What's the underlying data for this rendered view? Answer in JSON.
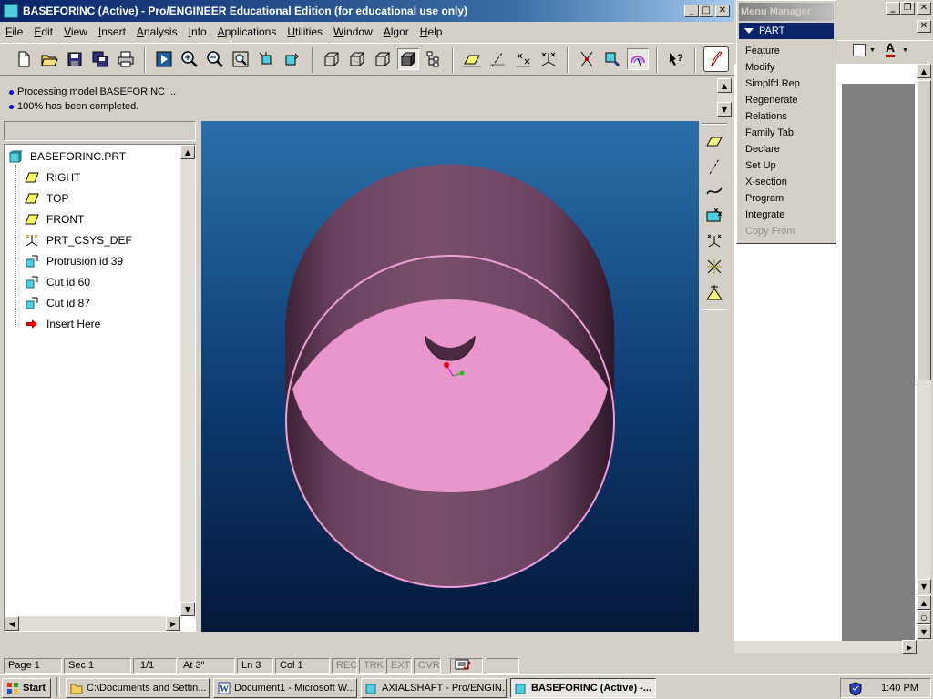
{
  "window": {
    "title": "BASEFORINC (Active) - Pro/ENGINEER Educational Edition (for educational use only)"
  },
  "menubar": [
    "File",
    "Edit",
    "View",
    "Insert",
    "Analysis",
    "Info",
    "Applications",
    "Utilities",
    "Window",
    "Algor",
    "Help"
  ],
  "messages": [
    "Processing model BASEFORINC ...",
    "100% has been completed."
  ],
  "model_tree": {
    "root": "BASEFORINC.PRT",
    "items": [
      "RIGHT",
      "TOP",
      "FRONT",
      "PRT_CSYS_DEF",
      "Protrusion id 39",
      "Cut id 60",
      "Cut id 87",
      "Insert Here"
    ]
  },
  "menu_manager": {
    "title": "Menu Manager",
    "section": "PART",
    "items": [
      "Feature",
      "Modify",
      "Simplfd Rep",
      "Regenerate",
      "Relations",
      "Family Tab",
      "Declare",
      "Set Up",
      "X-section",
      "Program",
      "Integrate",
      "Copy From"
    ],
    "disabled": [
      "Copy From"
    ]
  },
  "status": {
    "page": "Page  1",
    "sec": "Sec  1",
    "pages": "1/1",
    "at": "At  3\"",
    "ln": "Ln  3",
    "col": "Col  1",
    "rec": "REC",
    "trk": "TRK",
    "ext": "EXT",
    "ovr": "OVR"
  },
  "taskbar": {
    "start": "Start",
    "tasks": [
      "C:\\Documents and Settin...",
      "Document1 - Microsoft W...",
      "AXIALSHAFT - Pro/ENGIN...",
      "BASEFORINC (Active) -..."
    ],
    "clock": "1:40 PM"
  },
  "colors": {
    "title_active": "#0a246a",
    "viewport_top": "#2a6fa9",
    "viewport_bottom": "#06183a",
    "model_face": "#e896cc",
    "model_side": "#6e4560"
  },
  "icons": {
    "toolbar": [
      "new-icon",
      "open-icon",
      "save-icon",
      "save-copy-icon",
      "print-icon",
      "repaint-icon",
      "zoom-in-icon",
      "zoom-out-icon",
      "fit-icon",
      "orient-icon",
      "view-list-icon",
      "wireframe-icon",
      "hidden-line-icon",
      "no-hidden-icon",
      "shaded-icon",
      "model-tree-icon",
      "datum-plane-icon",
      "datum-axis-icon",
      "datum-point-icon",
      "coordinate-system-icon",
      "spin-center-icon",
      "layers-icon",
      "named-view-icon",
      "context-help-icon",
      "sketch-icon"
    ],
    "right_toolbar": [
      "datum-plane-tool-icon",
      "datum-axis-tool-icon",
      "datum-curve-tool-icon",
      "datum-point-tool-icon",
      "coordinate-system-tool-icon",
      "analysis-tool-icon",
      "evaluate-tool-icon"
    ]
  }
}
